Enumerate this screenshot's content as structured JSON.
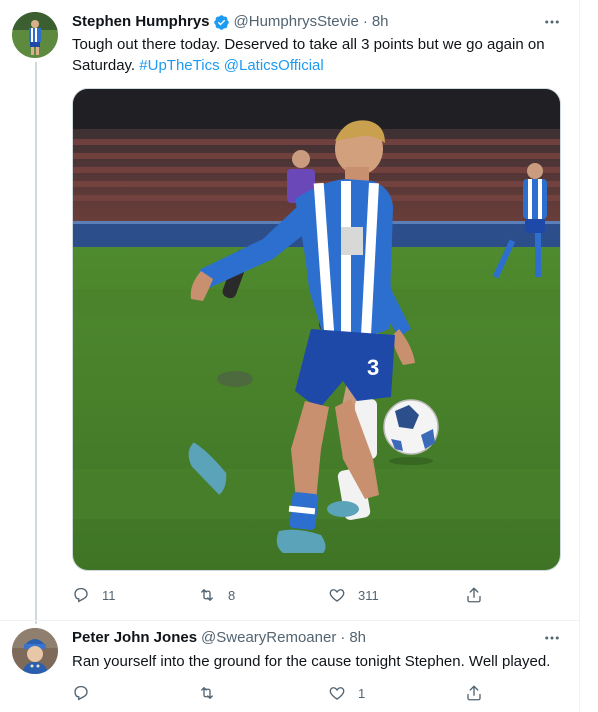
{
  "tweet": {
    "display_name": "Stephen Humphrys",
    "verified": true,
    "handle": "@HumphrysStevie",
    "separator": "·",
    "time": "8h",
    "text_part1": "Tough out there today. Deserved to take all 3 points but we go again on Saturday. ",
    "hashtag": "#UpTheTics",
    "mention": "@LaticsOfficial",
    "media_icon": "football-match-photo",
    "actions": {
      "replies": "11",
      "retweets": "8",
      "likes": "311",
      "share": ""
    }
  },
  "reply": {
    "display_name": "Peter John Jones",
    "handle": "@SwearyRemoaner",
    "separator": "·",
    "time": "8h",
    "text": "Ran yourself into the ground for the cause tonight Stephen. Well played.",
    "actions": {
      "replies": "",
      "retweets": "",
      "likes": "1",
      "share": ""
    }
  },
  "icons": {
    "more": "more-icon",
    "reply": "reply-icon",
    "retweet": "retweet-icon",
    "like": "like-icon",
    "share": "share-icon",
    "verified": "verified-icon"
  },
  "colors": {
    "link": "#1d9bf0",
    "secondary_text": "#536471",
    "primary_text": "#0f1419",
    "verified": "#1d9bf0"
  }
}
